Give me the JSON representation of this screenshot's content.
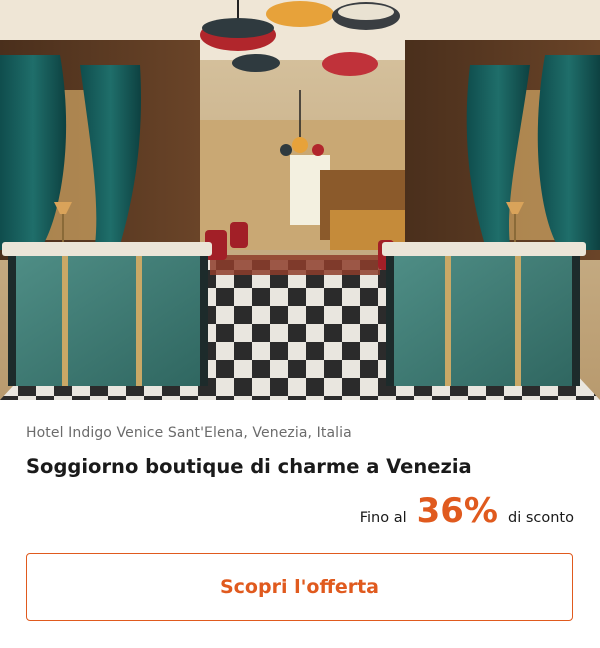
{
  "offer": {
    "location": "Hotel Indigo Venice Sant'Elena, Venezia, Italia",
    "title": "Soggiorno boutique di charme a Venezia",
    "discount_prefix": "Fino al",
    "discount_value": "36%",
    "discount_suffix": "di sconto",
    "cta_label": "Scopri l'offerta"
  },
  "colors": {
    "accent": "#e05a1e",
    "text": "#1a1a1a",
    "muted": "#6b6b6b"
  },
  "image": {
    "subject": "hotel-lobby-photo"
  }
}
